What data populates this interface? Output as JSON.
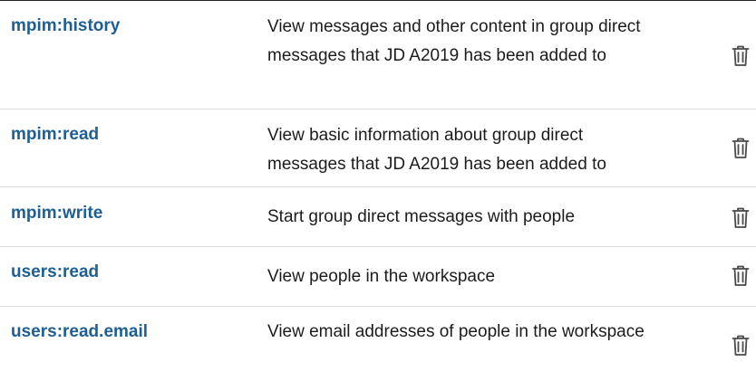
{
  "scopes": [
    {
      "name": "mpim:history",
      "description": "View messages and other content in group direct messages that JD A2019 has been added to",
      "delete_icon": "trash-icon"
    },
    {
      "name": "mpim:read",
      "description": "View basic information about group direct messages that JD A2019 has been added to",
      "delete_icon": "trash-icon"
    },
    {
      "name": "mpim:write",
      "description": "Start group direct messages with people",
      "delete_icon": "trash-icon"
    },
    {
      "name": "users:read",
      "description": "View people in the workspace",
      "delete_icon": "trash-icon"
    },
    {
      "name": "users:read.email",
      "description": "View email addresses of people in the workspace",
      "delete_icon": "trash-icon"
    }
  ],
  "colors": {
    "scope_name": "#1d5f94",
    "description": "#1d1c1d",
    "icon": "#4a4a4a",
    "divider": "#dcdcdc"
  }
}
